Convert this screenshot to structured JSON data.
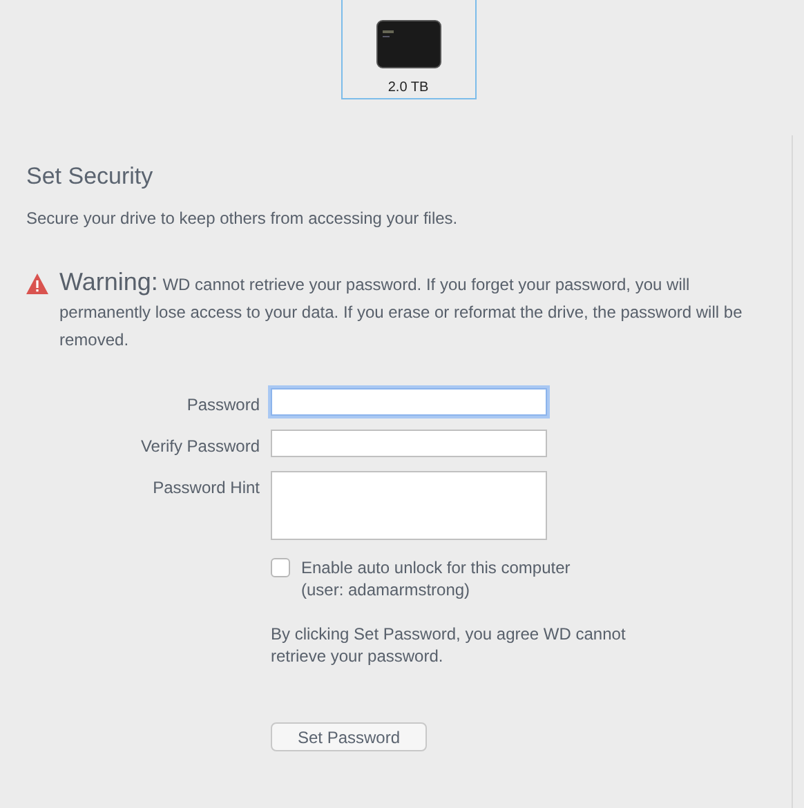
{
  "drive": {
    "capacity": "2.0 TB",
    "selected": true
  },
  "section": {
    "title": "Set Security",
    "description": "Secure your drive to keep others from accessing your files."
  },
  "warning": {
    "label": "Warning:",
    "text": "WD cannot retrieve your password. If you forget your password, you will permanently lose access to your data. If you erase or reformat the drive, the password will be removed."
  },
  "fields": [
    {
      "label": "Password",
      "kind": "input",
      "focused": true
    },
    {
      "label": "Verify Password",
      "kind": "input",
      "focused": false
    },
    {
      "label": "Password Hint",
      "kind": "textarea",
      "focused": false
    }
  ],
  "auto_unlock": {
    "label": "Enable auto unlock for this computer (user: adamarmstrong)",
    "checked": false
  },
  "agreement": "By clicking Set Password, you agree WD cannot retrieve your password.",
  "submit_button": "Set Password"
}
